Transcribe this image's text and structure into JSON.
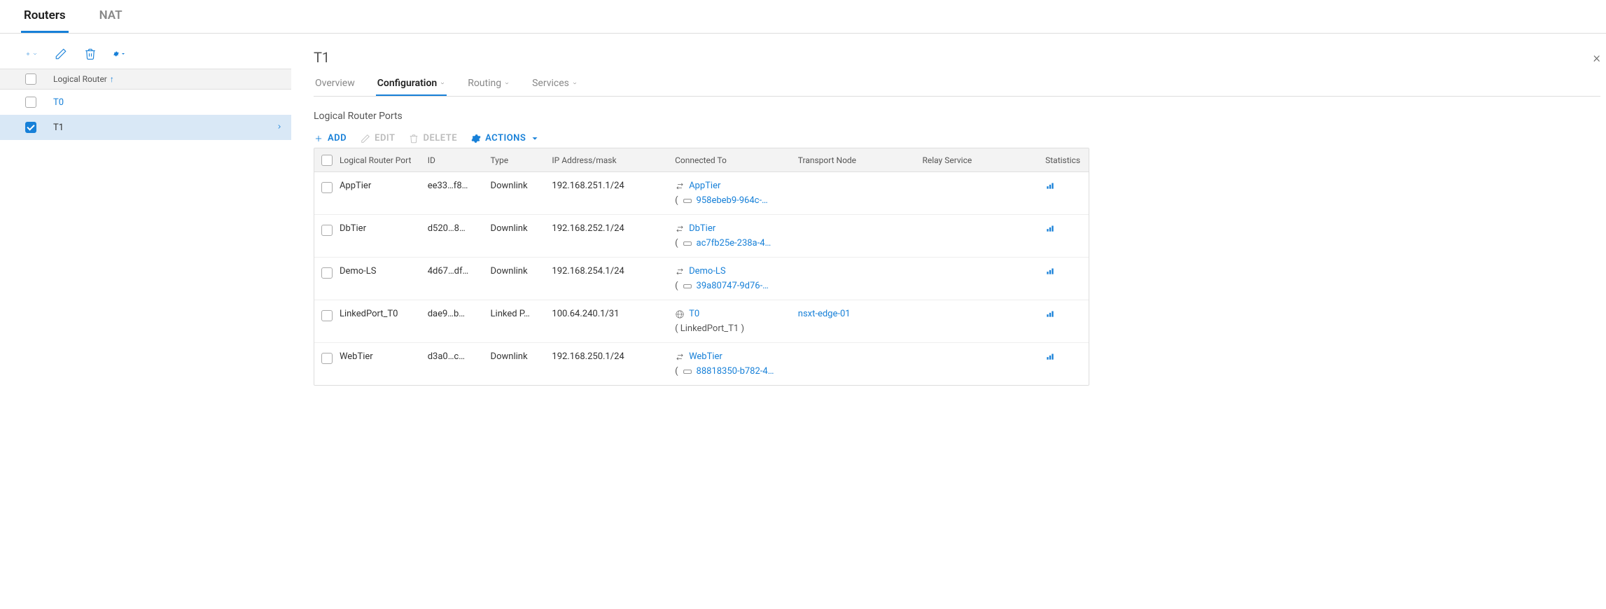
{
  "tabs": {
    "routers": "Routers",
    "nat": "NAT",
    "active": "routers"
  },
  "sidebar": {
    "header": "Logical Router",
    "sort_indicator": "↑",
    "items": [
      {
        "label": "T0",
        "selected": false
      },
      {
        "label": "T1",
        "selected": true
      }
    ]
  },
  "detail": {
    "title": "T1",
    "tabs": {
      "overview": "Overview",
      "configuration": "Configuration",
      "routing": "Routing",
      "services": "Services",
      "active": "configuration"
    },
    "ports_title": "Logical Router Ports",
    "toolbar": {
      "add": "ADD",
      "edit": "EDIT",
      "delete": "DELETE",
      "actions": "ACTIONS"
    },
    "table": {
      "headers": {
        "name": "Logical Router Port",
        "id": "ID",
        "type": "Type",
        "ip": "IP Address/mask",
        "conn": "Connected To",
        "tn": "Transport Node",
        "rs": "Relay Service",
        "stat": "Statistics"
      },
      "rows": [
        {
          "name": "AppTier",
          "id": "ee33…f8…",
          "type": "Downlink",
          "ip": "192.168.251.1/24",
          "conn_link": "AppTier",
          "conn_kind": "swap",
          "conn_sub": "958ebeb9-964c-…",
          "conn_sub_prefix": "(",
          "conn_sub_icon": "switch",
          "tn": "",
          "rs": ""
        },
        {
          "name": "DbTier",
          "id": "d520…8…",
          "type": "Downlink",
          "ip": "192.168.252.1/24",
          "conn_link": "DbTier",
          "conn_kind": "swap",
          "conn_sub": "ac7fb25e-238a-4…",
          "conn_sub_prefix": "(",
          "conn_sub_icon": "switch",
          "tn": "",
          "rs": ""
        },
        {
          "name": "Demo-LS",
          "id": "4d67…df…",
          "type": "Downlink",
          "ip": "192.168.254.1/24",
          "conn_link": "Demo-LS",
          "conn_kind": "swap",
          "conn_sub": "39a80747-9d76-…",
          "conn_sub_prefix": "(",
          "conn_sub_icon": "switch",
          "tn": "",
          "rs": ""
        },
        {
          "name": "LinkedPort_T0",
          "id": "dae9…b…",
          "type": "Linked P…",
          "ip": "100.64.240.1/31",
          "conn_link": "T0",
          "conn_kind": "globe",
          "conn_sub": "( LinkedPort_T1 )",
          "conn_sub_prefix": "",
          "conn_sub_icon": "none",
          "tn": "nsxt-edge-01",
          "rs": ""
        },
        {
          "name": "WebTier",
          "id": "d3a0…c…",
          "type": "Downlink",
          "ip": "192.168.250.1/24",
          "conn_link": "WebTier",
          "conn_kind": "swap",
          "conn_sub": "88818350-b782-4…",
          "conn_sub_prefix": "(",
          "conn_sub_icon": "switch",
          "tn": "",
          "rs": ""
        }
      ]
    }
  }
}
